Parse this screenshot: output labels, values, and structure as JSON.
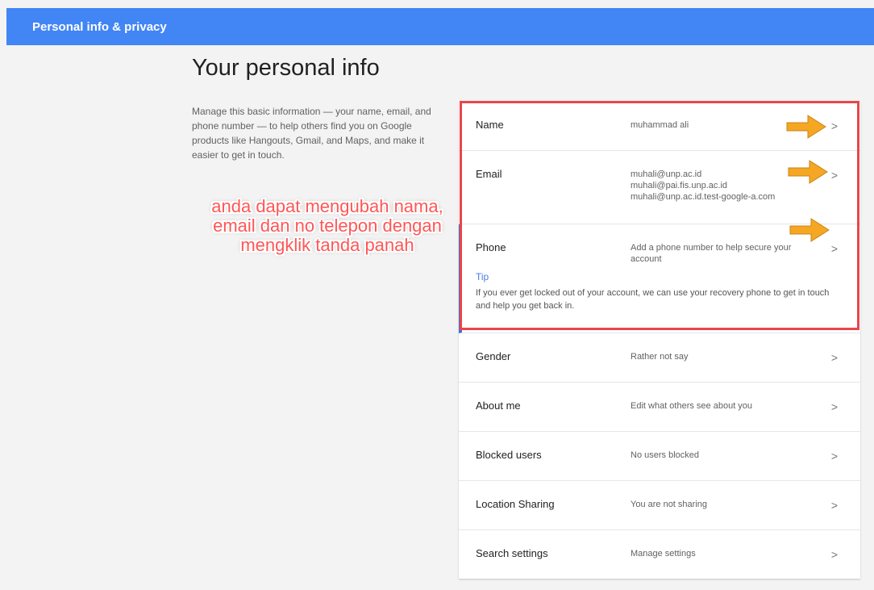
{
  "header": {
    "title": "Personal info & privacy"
  },
  "page": {
    "title": "Your personal info",
    "description": "Manage this basic information — your name, email, and phone number — to help others find you on Google products like Hangouts, Gmail, and Maps, and make it easier to get in touch."
  },
  "annotation": {
    "text": "anda dapat mengubah nama, email dan no telepon dengan mengklik tanda panah"
  },
  "rows": {
    "name": {
      "label": "Name",
      "value": "muhammad ali"
    },
    "email": {
      "label": "Email",
      "values": [
        "muhali@unp.ac.id",
        "muhali@pai.fis.unp.ac.id",
        "muhali@unp.ac.id.test-google-a.com"
      ]
    },
    "phone": {
      "label": "Phone",
      "value": "Add a phone number to help secure your account",
      "tip_label": "Tip",
      "tip_text": "If you ever get locked out of your account, we can use your recovery phone to get in touch and help you get back in."
    },
    "gender": {
      "label": "Gender",
      "value": "Rather not say"
    },
    "about": {
      "label": "About me",
      "value": "Edit what others see about you"
    },
    "blocked": {
      "label": "Blocked users",
      "value": "No users blocked"
    },
    "location": {
      "label": "Location Sharing",
      "value": "You are not sharing"
    },
    "search": {
      "label": "Search settings",
      "value": "Manage settings"
    }
  },
  "chevron_glyph": ">",
  "colors": {
    "header_bg": "#4285f4",
    "highlight_border": "#e8464a",
    "annotation_text": "#ff5656",
    "arrow": "#f5a623",
    "tip": "#4a7fe0"
  }
}
